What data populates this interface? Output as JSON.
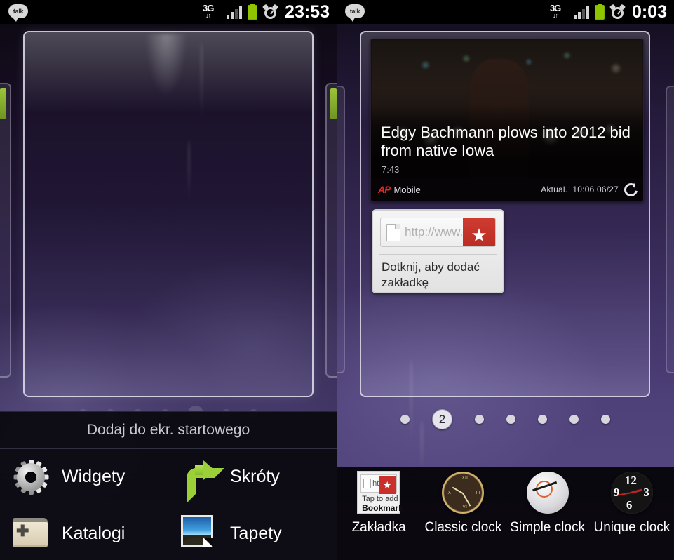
{
  "left": {
    "statusbar": {
      "talk_label": "talk",
      "network": "3G",
      "clock": "23:53",
      "icons": [
        "talk-icon",
        "3g-data-icon",
        "signal-bars-icon",
        "battery-icon",
        "alarm-icon"
      ]
    },
    "sheet": {
      "title": "Dodaj do ekr. startowego",
      "items": [
        {
          "label": "Widgety",
          "icon": "gear-icon"
        },
        {
          "label": "Skróty",
          "icon": "green-arrow-icon"
        },
        {
          "label": "Katalogi",
          "icon": "folder-plus-icon"
        },
        {
          "label": "Tapety",
          "icon": "picture-icon"
        }
      ]
    }
  },
  "right": {
    "statusbar": {
      "talk_label": "talk",
      "network": "3G",
      "clock": "0:03",
      "icons": [
        "talk-icon",
        "3g-data-icon",
        "signal-bars-icon",
        "battery-icon",
        "alarm-icon"
      ]
    },
    "news_widget": {
      "headline": "Edgy Bachmann plows into 2012 bid from native Iowa",
      "time": "7:43",
      "source_logo": "AP",
      "source_name": "Mobile",
      "updated_label": "Aktual.",
      "updated_value": "10:06 06/27",
      "refresh_icon": "refresh-icon"
    },
    "bookmark_widget": {
      "url_placeholder": "http://www.",
      "caption": "Dotknij, aby dodać zakładkę",
      "star_glyph": "★",
      "page_icon": "page-icon"
    },
    "clock_widget": {
      "numbers": [
        "12",
        "3",
        "6",
        "9"
      ],
      "hour_deg": 2,
      "minute_deg": 18,
      "second_deg": 1
    },
    "page_indicator": {
      "count": 7,
      "current_index": 1,
      "current_label": "2"
    },
    "tray": {
      "items": [
        {
          "label": "Zakładka",
          "icon": "bookmark-widget-icon",
          "mini_http": "http",
          "mini_line1": "Tap to add",
          "mini_line2": "Bookmark",
          "mini_star": "★"
        },
        {
          "label": "Classic clock",
          "icon": "classic-clock-icon"
        },
        {
          "label": "Simple clock",
          "icon": "simple-clock-icon"
        },
        {
          "label": "Unique clock",
          "icon": "unique-clock-icon"
        }
      ]
    }
  },
  "colors": {
    "battery_green": "#8fc400",
    "accent_green": "#9bd036",
    "bookmark_red": "#c9302c",
    "wallpaper_purple": "#4e4079"
  }
}
